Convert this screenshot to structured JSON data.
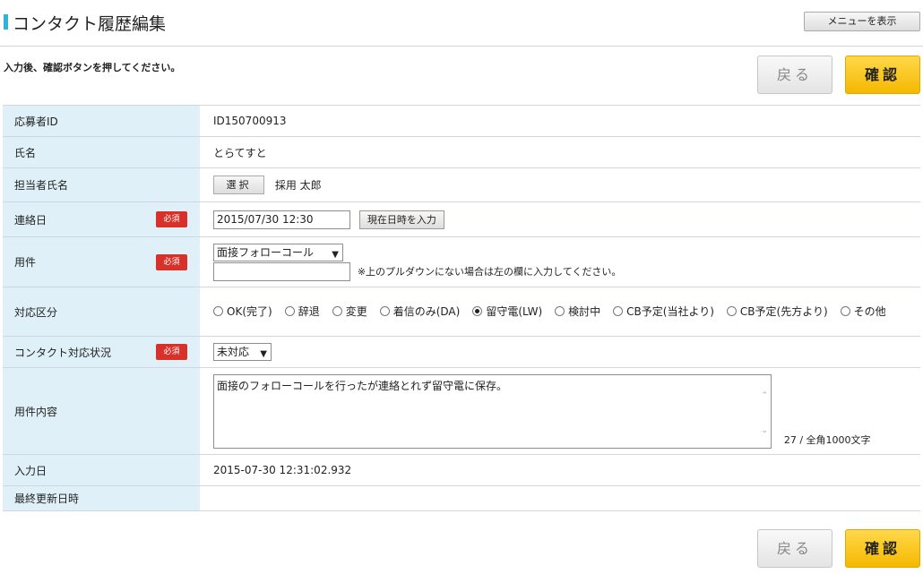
{
  "header": {
    "title": "コンタクト履歴編集",
    "menu_button": "メニューを表示"
  },
  "instruction": "入力後、確認ボタンを押してください。",
  "buttons": {
    "back": "戻る",
    "confirm": "確認"
  },
  "required_badge": "必須",
  "rows": {
    "applicant_id": {
      "label": "応募者ID",
      "value": "ID150700913"
    },
    "name": {
      "label": "氏名",
      "value": "とらてすと"
    },
    "manager": {
      "label": "担当者氏名",
      "select_button": "選択",
      "value": "採用 太郎"
    },
    "contact_date": {
      "label": "連絡日",
      "value": "2015/07/30 12:30",
      "now_button": "現在日時を入力"
    },
    "subject": {
      "label": "用件",
      "selected": "面接フォローコール",
      "other_value": "",
      "note": "※上のプルダウンにない場合は左の欄に入力してください。"
    },
    "response_type": {
      "label": "対応区分",
      "options": [
        "OK(完了)",
        "辞退",
        "変更",
        "着信のみ(DA)",
        "留守電(LW)",
        "検討中",
        "CB予定(当社より)",
        "CB予定(先方より)",
        "その他"
      ],
      "selected": "留守電(LW)"
    },
    "status": {
      "label": "コンタクト対応状況",
      "selected": "未対応"
    },
    "content": {
      "label": "用件内容",
      "value": "面接のフォローコールを行ったが連絡とれず留守電に保存。",
      "counter": "27 / 全角1000文字"
    },
    "input_date": {
      "label": "入力日",
      "value": "2015-07-30 12:31:02.932"
    },
    "last_updated": {
      "label": "最終更新日時",
      "value": ""
    }
  },
  "colors": {
    "accent": "#2fb3d8",
    "label_bg": "#dff0f8",
    "required": "#d8312a",
    "confirm": "#f5b800"
  }
}
